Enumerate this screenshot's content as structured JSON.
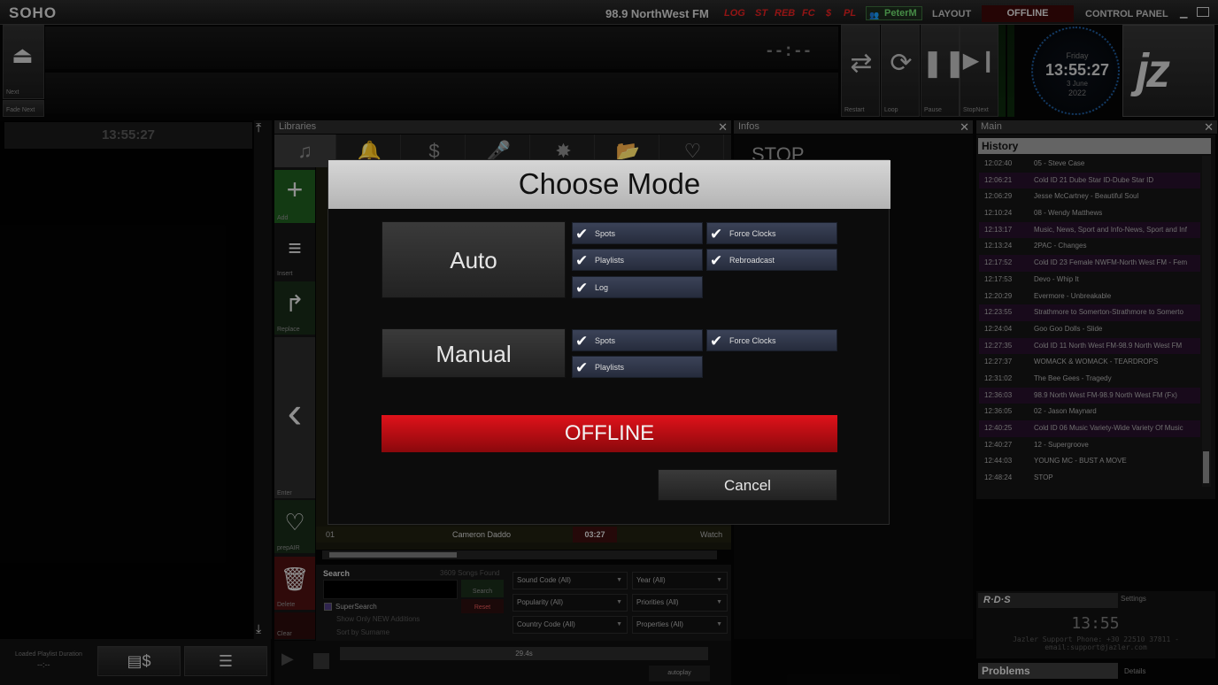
{
  "topbar": {
    "app_name": "SOHO",
    "station": "98.9 NorthWest FM",
    "tags": [
      "LOG",
      "ST",
      "REB",
      "FC",
      "$",
      "PL"
    ],
    "user": "PeterM",
    "layout_label": "LAYOUT",
    "status": "OFFLINE",
    "control_panel_label": "CONTROL PANEL"
  },
  "player": {
    "next_label": "Next",
    "fade_next_label": "Fade Next",
    "counter": "--:--",
    "buttons": [
      {
        "label": "Restart",
        "icon": "restart-icon",
        "glyph": "⇄"
      },
      {
        "label": "Loop",
        "icon": "loop-icon",
        "glyph": "⟳"
      },
      {
        "label": "Pause",
        "icon": "pause-icon",
        "glyph": "❚❚"
      },
      {
        "label": "StopNext",
        "icon": "stop-next-icon",
        "glyph": "▶❙"
      }
    ]
  },
  "clock": {
    "day": "Friday",
    "time": "13:55:27",
    "date": "3 June",
    "year": "2022"
  },
  "logo_text": "jz",
  "left_panel": {
    "time": "13:55:27",
    "loaded_duration_label": "Loaded Playlist Duration",
    "loaded_duration_value": "--:--"
  },
  "libraries": {
    "title": "Libraries",
    "tabs": [
      {
        "icon": "music-notes-icon",
        "glyph": "♫"
      },
      {
        "icon": "bell-icon",
        "glyph": "🔔"
      },
      {
        "icon": "money-icon",
        "glyph": "$"
      },
      {
        "icon": "microphone-icon",
        "glyph": "🎤"
      },
      {
        "icon": "explosion-icon",
        "glyph": "✸"
      },
      {
        "icon": "folder-arrow-icon",
        "glyph": "📂"
      },
      {
        "icon": "heart-plus-icon",
        "glyph": "♡"
      }
    ],
    "actions": [
      {
        "label": "Add",
        "icon": "plus-icon",
        "glyph": "+"
      },
      {
        "label": "Insert",
        "icon": "insert-icon",
        "glyph": "≡"
      },
      {
        "label": "Replace",
        "icon": "replace-arrow-icon",
        "glyph": "↱"
      },
      {
        "label": "Enter",
        "icon": "chevron-left-icon",
        "glyph": "‹"
      },
      {
        "label": "prepAIR",
        "icon": "heart-plus-icon",
        "glyph": "♡"
      },
      {
        "label": "Delete",
        "icon": "trash-icon",
        "glyph": "🗑"
      },
      {
        "label": "Clear",
        "icon": "clear-icon",
        "glyph": ""
      }
    ],
    "row": {
      "index": "01",
      "title": "Cameron Daddo",
      "duration": "03:27",
      "extra": "Watch"
    },
    "search": {
      "label": "Search",
      "songs_found": "3609 Songs Found",
      "search_button": "Search",
      "reset_button": "Reset",
      "supersearch": "SuperSearch",
      "only_new": "Show Only NEW Additions",
      "sort_surname": "Sort by Surname",
      "filters": [
        "Sound Code (All)",
        "Year (All)",
        "Popularity (All)",
        "Priorities (All)",
        "Country Code (All)",
        "Properties (All)"
      ]
    },
    "progress_text": "29.4s",
    "autoplay_label": "autoplay"
  },
  "infos": {
    "title": "Infos",
    "stop_text": "STOP"
  },
  "main": {
    "title": "Main",
    "history_title": "History",
    "history": [
      {
        "time": "12:02:40",
        "text": "05 - Steve Case",
        "alt": false
      },
      {
        "time": "12:06:21",
        "text": "Cold ID 21 Dube Star ID-Dube Star ID",
        "alt": true
      },
      {
        "time": "12:06:29",
        "text": "Jesse McCartney - Beautiful Soul",
        "alt": false
      },
      {
        "time": "12:10:24",
        "text": "08 - Wendy Matthews",
        "alt": false
      },
      {
        "time": "12:13:17",
        "text": "Music, News, Sport and Info-News, Sport and Inf",
        "alt": true
      },
      {
        "time": "12:13:24",
        "text": "2PAC - Changes",
        "alt": false
      },
      {
        "time": "12:17:52",
        "text": "Cold ID 23 Female NWFM-North West FM - Fem",
        "alt": true
      },
      {
        "time": "12:17:53",
        "text": "Devo - Whip It",
        "alt": false
      },
      {
        "time": "12:20:29",
        "text": "Evermore - Unbreakable",
        "alt": false
      },
      {
        "time": "12:23:55",
        "text": "Strathmore to Somerton-Strathmore to Somerto",
        "alt": true
      },
      {
        "time": "12:24:04",
        "text": "Goo Goo Dolls - Slide",
        "alt": false
      },
      {
        "time": "12:27:35",
        "text": "Cold ID 11 North West FM-98.9 North West FM",
        "alt": true
      },
      {
        "time": "12:27:37",
        "text": "WOMACK & WOMACK - TEARDROPS",
        "alt": false
      },
      {
        "time": "12:31:02",
        "text": "The Bee Gees - Tragedy",
        "alt": false
      },
      {
        "time": "12:36:03",
        "text": "98.9 North West FM-98.9 North West FM (Fx)",
        "alt": true
      },
      {
        "time": "12:36:05",
        "text": "02 - Jason Maynard",
        "alt": false
      },
      {
        "time": "12:40:25",
        "text": "Cold ID 06 Music Variety-Wide Variety Of Music",
        "alt": true
      },
      {
        "time": "12:40:27",
        "text": "12 - Supergroove",
        "alt": false
      },
      {
        "time": "12:44:03",
        "text": "YOUNG MC - BUST A MOVE",
        "alt": false
      },
      {
        "time": "12:48:24",
        "text": "STOP",
        "alt": false
      }
    ]
  },
  "rds": {
    "title": "R·D·S",
    "settings_label": "Settings",
    "time": "13:55",
    "message": "Jazler Support Phone: +30 22510 37811 - email:support@jazler.com"
  },
  "problems": {
    "title": "Problems",
    "details_label": "Details"
  },
  "modal": {
    "title": "Choose Mode",
    "auto_label": "Auto",
    "manual_label": "Manual",
    "auto_options": [
      "Spots",
      "Force Clocks",
      "Playlists",
      "Rebroadcast",
      "Log"
    ],
    "manual_options": [
      "Spots",
      "Force Clocks",
      "Playlists"
    ],
    "offline_label": "OFFLINE",
    "cancel_label": "Cancel"
  },
  "colors": {
    "offline_red": "#e0121a",
    "option_blue": "#343c52",
    "history_alt": "#26102a"
  }
}
